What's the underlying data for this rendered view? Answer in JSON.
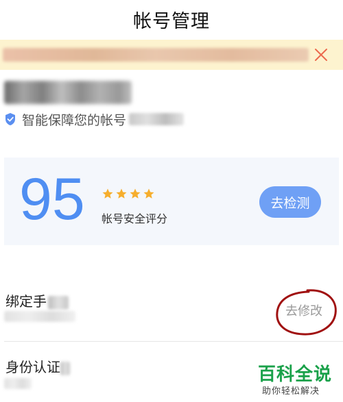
{
  "header": {
    "title": "帐号管理"
  },
  "banner": {
    "close_icon": "close-icon",
    "accent": "#ec6a4e",
    "background": "#fdf3cf"
  },
  "account": {
    "protect_text": "智能保障您的帐号",
    "protect_icon": "shield-icon"
  },
  "score_card": {
    "score": "95",
    "star_count": 4,
    "label": "帐号安全评分",
    "check_button": "去检测",
    "score_color": "#4f8ef2",
    "star_color": "#f6ae2d"
  },
  "rows": [
    {
      "label": "绑定手",
      "action": "去修改"
    },
    {
      "label": "身份认证"
    }
  ],
  "watermark": {
    "main": "百科全说",
    "sub": "助你轻松解决"
  }
}
